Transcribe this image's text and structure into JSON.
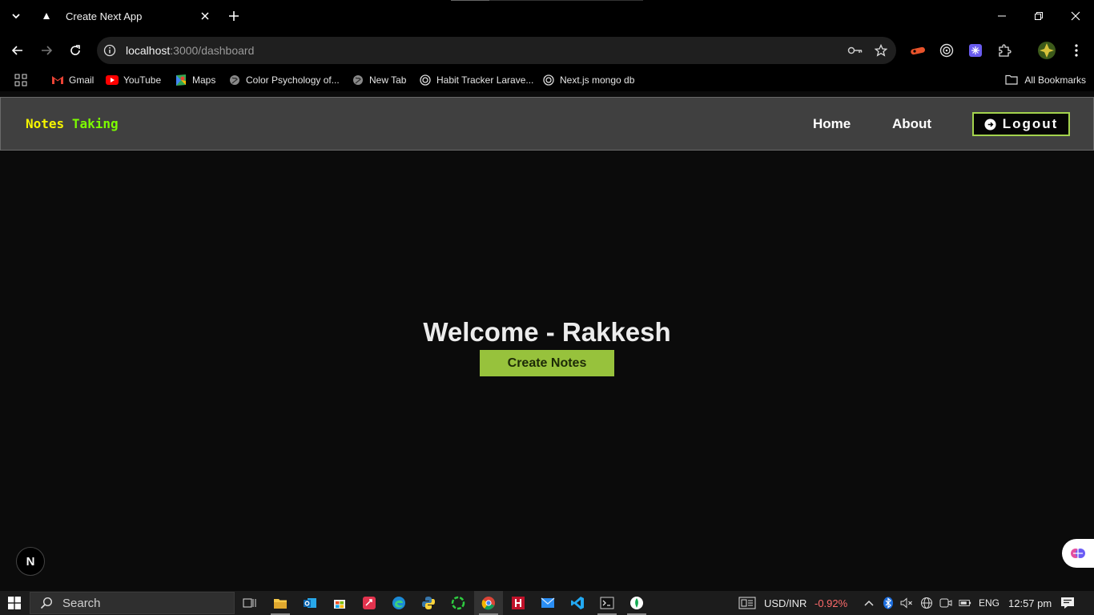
{
  "browser": {
    "tab_title": "Create Next App",
    "url_host": "localhost",
    "url_path": ":3000/dashboard",
    "bookmarks": [
      {
        "label": "Gmail",
        "icon": "gmail-icon"
      },
      {
        "label": "YouTube",
        "icon": "youtube-icon"
      },
      {
        "label": "Maps",
        "icon": "maps-icon"
      },
      {
        "label": "Color Psychology of...",
        "icon": "globe-icon"
      },
      {
        "label": "New Tab",
        "icon": "globe-icon"
      },
      {
        "label": "Habit Tracker Larave...",
        "icon": "openai-icon"
      },
      {
        "label": "Next.js mongo db",
        "icon": "openai-icon"
      }
    ],
    "all_bookmarks_label": "All Bookmarks"
  },
  "app": {
    "brand_word1": "Notes",
    "brand_word2": "Taking",
    "nav": {
      "home": "Home",
      "about": "About",
      "logout": "Logout"
    },
    "welcome": "Welcome - Rakkesh",
    "create_button": "Create Notes",
    "nextjs_badge": "N"
  },
  "taskbar": {
    "search_placeholder": "Search",
    "ticker_symbol": "USD/INR",
    "ticker_change": "-0.92%",
    "language": "ENG",
    "time": "12:57 pm"
  },
  "colors": {
    "brand_yellow": "#f5f500",
    "brand_green": "#7CFC00",
    "accent_green": "#97c23c",
    "ticker_negative": "#ff6b6b"
  }
}
